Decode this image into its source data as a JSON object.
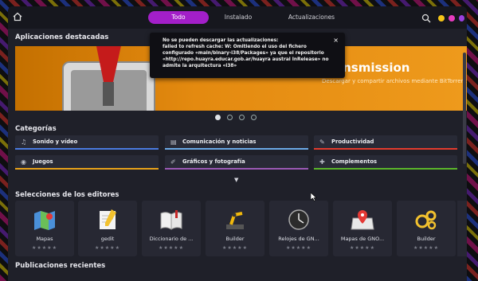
{
  "header": {
    "tabs": [
      {
        "label": "Todo",
        "active": true
      },
      {
        "label": "Instalado",
        "active": false
      },
      {
        "label": "Actualizaciones",
        "active": false
      }
    ],
    "window_controls": [
      "#f5c518",
      "#e63cbe",
      "#9b3fe0"
    ]
  },
  "featured": {
    "title": "Aplicaciones destacadas",
    "banner_title": "Transmission",
    "banner_subtitle": "Descargar y compartir archivos mediante BitTorrent",
    "pages": 4,
    "active_page": 1
  },
  "categories": {
    "title": "Categorías",
    "items": [
      {
        "label": "Sonido y vídeo",
        "icon": "music-note-icon",
        "color": "#4a7be0"
      },
      {
        "label": "Comunicación y noticias",
        "icon": "chat-icon",
        "color": "#6ba9e6"
      },
      {
        "label": "Productividad",
        "icon": "edit-icon",
        "color": "#e23b2e"
      },
      {
        "label": "Juegos",
        "icon": "gamepad-icon",
        "color": "#e8a21a"
      },
      {
        "label": "Gráficos y fotografía",
        "icon": "brush-icon",
        "color": "#9b59b6"
      },
      {
        "label": "Complementos",
        "icon": "puzzle-icon",
        "color": "#5bb62a"
      }
    ]
  },
  "editors": {
    "title": "Selecciones de los editores",
    "apps": [
      {
        "name": "Mapas",
        "icon": "map-icon"
      },
      {
        "name": "gedit",
        "icon": "text-editor-icon"
      },
      {
        "name": "Diccionario de ...",
        "icon": "dictionary-icon"
      },
      {
        "name": "Builder",
        "icon": "builder-icon"
      },
      {
        "name": "Relojes de GN...",
        "icon": "clock-icon"
      },
      {
        "name": "Mapas de GNO...",
        "icon": "map-pin-icon"
      },
      {
        "name": "Builder",
        "icon": "gears-icon"
      }
    ],
    "stars": "★★★★★"
  },
  "recent": {
    "title": "Publicaciones recientes"
  },
  "notification": {
    "text": "No se pueden descargar las actualizaciones:\nfailed to refresh cache: W: Omitiendo el uso del fichero\nconfigurado «main/binary-i38/Packages» ya que el repositorio\n«http://repo.huayra.educar.gob.ar/huayra austral InRelease» no\nadmite la arquitectura «i38»",
    "close": "×"
  }
}
